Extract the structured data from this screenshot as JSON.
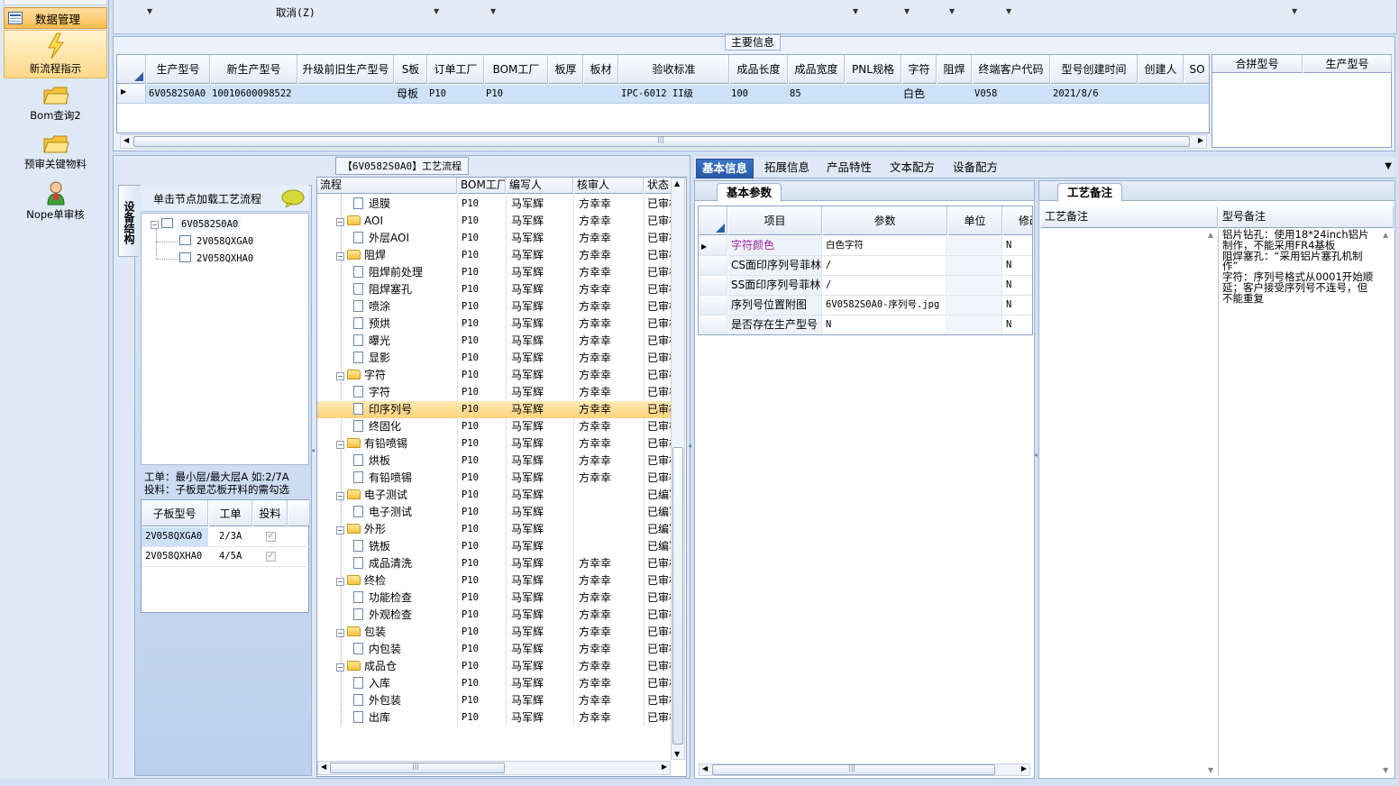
{
  "nav": {
    "header": "数据管理",
    "items": [
      {
        "label": "新流程指示",
        "icon": "lightning-icon"
      },
      {
        "label": "Bom查询2",
        "icon": "folder-icon"
      },
      {
        "label": "预审关键物料",
        "icon": "folder-icon"
      },
      {
        "label": "Nope单审核",
        "icon": "user-icon"
      }
    ]
  },
  "toolbar": {
    "cancel_label": "取消(Z)"
  },
  "main_info": {
    "title": "主要信息",
    "columns": [
      "生产型号",
      "新生产型号",
      "升级前旧生产型号",
      "S板",
      "订单工厂",
      "BOM工厂",
      "板厚",
      "板材",
      "验收标准",
      "成品长度",
      "成品宽度",
      "PNL规格",
      "字符",
      "阻焊",
      "终端客户代码",
      "型号创建时间",
      "创建人",
      "SO"
    ],
    "row": {
      "model": "6V0582S0A0",
      "new_model": "10010600098522",
      "old_model": "",
      "s_board": "母板",
      "order_factory": "P10",
      "bom_factory": "P10",
      "thickness": "",
      "material": "",
      "standard": "IPC-6012 II级",
      "length": "100",
      "width": "85",
      "pnl": "",
      "char": "白色",
      "solder": "",
      "customer_code": "V058",
      "created": "2021/8/6",
      "creator": "",
      "so": ""
    },
    "merge_columns": [
      "合拼型号",
      "生产型号"
    ]
  },
  "left_panel": {
    "vertical_tab": "设备结构",
    "load_hint": "单击节点加载工艺流程",
    "tree": [
      {
        "label": "6V0582S0A0",
        "level": 0
      },
      {
        "label": "2V058QXGA0",
        "level": 1
      },
      {
        "label": "2V058QXHA0",
        "level": 1
      }
    ],
    "note_line1": "工单：最小层/最大层A 如:2/7A",
    "note_line2": "投料：子板是芯板开料的需勾选",
    "sub_columns": [
      "子板型号",
      "工单",
      "投料"
    ],
    "sub_rows": [
      {
        "model": "2V058QXGA0",
        "order": "2/3A",
        "feed": true
      },
      {
        "model": "2V058QXHA0",
        "order": "4/5A",
        "feed": true
      }
    ]
  },
  "flow": {
    "title": "【6V0582S0A0】工艺流程",
    "columns": [
      "流程",
      "BOM工厂",
      "编写人",
      "核审人",
      "状态"
    ],
    "rows": [
      {
        "name": "退膜",
        "type": "doc",
        "factory": "P10",
        "writer": "马军辉",
        "reviewer": "方幸幸",
        "status": "已审核"
      },
      {
        "name": "AOI",
        "type": "folder",
        "factory": "P10",
        "writer": "马军辉",
        "reviewer": "方幸幸",
        "status": "已审核"
      },
      {
        "name": "外层AOI",
        "type": "doc",
        "factory": "P10",
        "writer": "马军辉",
        "reviewer": "方幸幸",
        "status": "已审核"
      },
      {
        "name": "阻焊",
        "type": "folder",
        "factory": "P10",
        "writer": "马军辉",
        "reviewer": "方幸幸",
        "status": "已审核"
      },
      {
        "name": "阻焊前处理",
        "type": "doc",
        "factory": "P10",
        "writer": "马军辉",
        "reviewer": "方幸幸",
        "status": "已审核"
      },
      {
        "name": "阻焊塞孔",
        "type": "doc",
        "factory": "P10",
        "writer": "马军辉",
        "reviewer": "方幸幸",
        "status": "已审核"
      },
      {
        "name": "喷涂",
        "type": "doc",
        "factory": "P10",
        "writer": "马军辉",
        "reviewer": "方幸幸",
        "status": "已审核"
      },
      {
        "name": "预烘",
        "type": "doc",
        "factory": "P10",
        "writer": "马军辉",
        "reviewer": "方幸幸",
        "status": "已审核"
      },
      {
        "name": "曝光",
        "type": "doc",
        "factory": "P10",
        "writer": "马军辉",
        "reviewer": "方幸幸",
        "status": "已审核"
      },
      {
        "name": "显影",
        "type": "doc",
        "factory": "P10",
        "writer": "马军辉",
        "reviewer": "方幸幸",
        "status": "已审核"
      },
      {
        "name": "字符",
        "type": "folder",
        "factory": "P10",
        "writer": "马军辉",
        "reviewer": "方幸幸",
        "status": "已审核"
      },
      {
        "name": "字符",
        "type": "doc",
        "factory": "P10",
        "writer": "马军辉",
        "reviewer": "方幸幸",
        "status": "已审核"
      },
      {
        "name": "印序列号",
        "type": "doc",
        "factory": "P10",
        "writer": "马军辉",
        "reviewer": "方幸幸",
        "status": "已审核",
        "selected": true
      },
      {
        "name": "终固化",
        "type": "doc",
        "factory": "P10",
        "writer": "马军辉",
        "reviewer": "方幸幸",
        "status": "已审核"
      },
      {
        "name": "有铅喷锡",
        "type": "folder",
        "factory": "P10",
        "writer": "马军辉",
        "reviewer": "方幸幸",
        "status": "已审核"
      },
      {
        "name": "烘板",
        "type": "doc",
        "factory": "P10",
        "writer": "马军辉",
        "reviewer": "方幸幸",
        "status": "已审核"
      },
      {
        "name": "有铅喷锡",
        "type": "doc",
        "factory": "P10",
        "writer": "马军辉",
        "reviewer": "方幸幸",
        "status": "已审核"
      },
      {
        "name": "电子测试",
        "type": "folder",
        "factory": "P10",
        "writer": "马军辉",
        "reviewer": "",
        "status": "已编写"
      },
      {
        "name": "电子测试",
        "type": "doc",
        "factory": "P10",
        "writer": "马军辉",
        "reviewer": "",
        "status": "已编写"
      },
      {
        "name": "外形",
        "type": "folder",
        "factory": "P10",
        "writer": "马军辉",
        "reviewer": "",
        "status": "已编写"
      },
      {
        "name": "铣板",
        "type": "doc",
        "factory": "P10",
        "writer": "马军辉",
        "reviewer": "",
        "status": "已编写"
      },
      {
        "name": "成品清洗",
        "type": "doc",
        "factory": "P10",
        "writer": "马军辉",
        "reviewer": "方幸幸",
        "status": "已审核"
      },
      {
        "name": "终检",
        "type": "folder",
        "factory": "P10",
        "writer": "马军辉",
        "reviewer": "方幸幸",
        "status": "已审核"
      },
      {
        "name": "功能检查",
        "type": "doc",
        "factory": "P10",
        "writer": "马军辉",
        "reviewer": "方幸幸",
        "status": "已审核"
      },
      {
        "name": "外观检查",
        "type": "doc",
        "factory": "P10",
        "writer": "马军辉",
        "reviewer": "方幸幸",
        "status": "已审核"
      },
      {
        "name": "包装",
        "type": "folder",
        "factory": "P10",
        "writer": "马军辉",
        "reviewer": "方幸幸",
        "status": "已审核"
      },
      {
        "name": "内包装",
        "type": "doc",
        "factory": "P10",
        "writer": "马军辉",
        "reviewer": "方幸幸",
        "status": "已审核"
      },
      {
        "name": "成品仓",
        "type": "folder",
        "factory": "P10",
        "writer": "马军辉",
        "reviewer": "方幸幸",
        "status": "已审核"
      },
      {
        "name": "入库",
        "type": "doc",
        "factory": "P10",
        "writer": "马军辉",
        "reviewer": "方幸幸",
        "status": "已审核"
      },
      {
        "name": "外包装",
        "type": "doc",
        "factory": "P10",
        "writer": "马军辉",
        "reviewer": "方幸幸",
        "status": "已审核"
      },
      {
        "name": "出库",
        "type": "doc",
        "factory": "P10",
        "writer": "马军辉",
        "reviewer": "方幸幸",
        "status": "已审核"
      }
    ]
  },
  "tabs": [
    "基本信息",
    "拓展信息",
    "产品特性",
    "文本配方",
    "设备配方"
  ],
  "basic": {
    "subtab": "基本参数",
    "columns": [
      "项目",
      "参数",
      "单位",
      "修改"
    ],
    "rows": [
      {
        "item": "字符颜色",
        "param": "白色字符",
        "unit": "",
        "mod": "N",
        "highlight": true
      },
      {
        "item": "CS面印序列号菲林",
        "param": "/",
        "unit": "",
        "mod": "N"
      },
      {
        "item": "SS面印序列号菲林",
        "param": "/",
        "unit": "",
        "mod": "N"
      },
      {
        "item": "序列号位置附图",
        "param": "6V0582S0A0-序列号.jpg",
        "unit": "",
        "mod": "N"
      },
      {
        "item": "是否存在生产型号",
        "param": "N",
        "unit": "",
        "mod": "N"
      }
    ]
  },
  "process_notes": {
    "subtab": "工艺备注",
    "columns": [
      "工艺备注",
      "型号备注"
    ],
    "model_note_lines": [
      "铝片钻孔：使用18*24inch铝片",
      "制作，不能采用FR4基板",
      "阻焊塞孔：“采用铝片塞孔机制",
      "作”",
      "字符：序列号格式从0001开始顺",
      "延；客户接受序列号不连号，但",
      "不能重复"
    ]
  },
  "colors": {
    "selected_row": "#ffd27a",
    "active_tab": "#255aa8",
    "grid_select": "#cde2f8",
    "highlight_text": "#a0249e"
  }
}
